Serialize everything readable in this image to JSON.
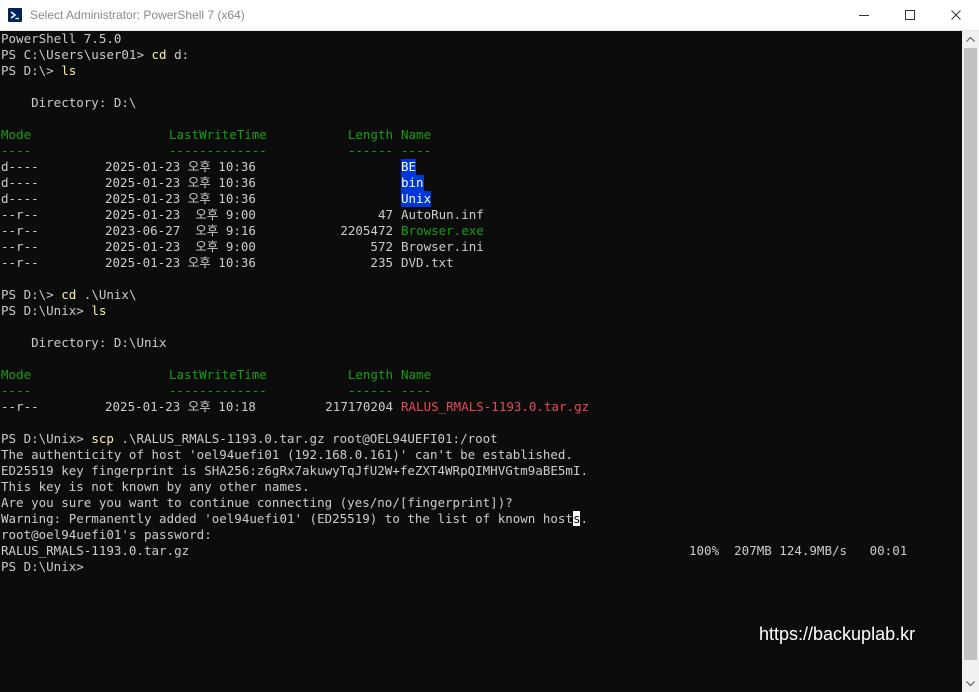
{
  "window": {
    "title": "Select Administrator: PowerShell 7 (x64)",
    "icon": "powershell-icon",
    "controls": [
      "minimize-icon",
      "maximize-icon",
      "close-icon"
    ]
  },
  "console": {
    "lines": [
      {
        "segments": [
          {
            "text": "PowerShell 7.5.0"
          }
        ]
      },
      {
        "segments": [
          {
            "text": "PS C:\\Users\\user01> "
          },
          {
            "text": "cd",
            "style": "yellow"
          },
          {
            "text": " d:"
          }
        ]
      },
      {
        "segments": [
          {
            "text": "PS D:\\> "
          },
          {
            "text": "ls",
            "style": "yellow"
          }
        ]
      },
      {
        "segments": []
      },
      {
        "segments": [
          {
            "text": "    Directory: D:\\"
          }
        ]
      },
      {
        "segments": []
      },
      {
        "segments": [
          {
            "text": "Mode",
            "style": "green"
          },
          {
            "text": "LastWriteTime",
            "style": "green"
          },
          {
            "text": "Length",
            "style": "green"
          },
          {
            "text": "Name",
            "style": "green"
          }
        ]
      },
      {
        "segments": [
          {
            "text": "----",
            "style": "green"
          },
          {
            "text": "-------------",
            "style": "green"
          },
          {
            "text": "------",
            "style": "green"
          },
          {
            "text": "----",
            "style": "green"
          }
        ]
      },
      {
        "segments": [
          {
            "text": "d----"
          },
          {
            "text": "2025-01-23 오후 10:36"
          },
          {
            "text": ""
          },
          {
            "text": "BE",
            "style": "dir"
          }
        ]
      },
      {
        "segments": [
          {
            "text": "d----"
          },
          {
            "text": "2025-01-23 오후 10:36"
          },
          {
            "text": ""
          },
          {
            "text": "bin",
            "style": "dir"
          }
        ]
      },
      {
        "segments": [
          {
            "text": "d----"
          },
          {
            "text": "2025-01-23 오후 10:36"
          },
          {
            "text": ""
          },
          {
            "text": "Unix",
            "style": "dir"
          }
        ]
      },
      {
        "segments": [
          {
            "text": "--r--"
          },
          {
            "text": "2025-01-23  오후 9:00"
          },
          {
            "text": "47"
          },
          {
            "text": "AutoRun.inf"
          }
        ]
      },
      {
        "segments": [
          {
            "text": "--r--"
          },
          {
            "text": "2023-06-27  오후 9:16"
          },
          {
            "text": "2205472"
          },
          {
            "text": "Browser.exe",
            "style": "green"
          }
        ]
      },
      {
        "segments": [
          {
            "text": "--r--"
          },
          {
            "text": "2025-01-23  오후 9:00"
          },
          {
            "text": "572"
          },
          {
            "text": "Browser.ini"
          }
        ]
      },
      {
        "segments": [
          {
            "text": "--r--"
          },
          {
            "text": "2025-01-23 오후 10:36"
          },
          {
            "text": "235"
          },
          {
            "text": "DVD.txt"
          }
        ]
      },
      {
        "segments": []
      },
      {
        "segments": [
          {
            "text": "PS D:\\> "
          },
          {
            "text": "cd",
            "style": "yellow"
          },
          {
            "text": " .\\Unix\\"
          }
        ]
      },
      {
        "segments": [
          {
            "text": "PS D:\\Unix> "
          },
          {
            "text": "ls",
            "style": "yellow"
          }
        ]
      },
      {
        "segments": []
      },
      {
        "segments": [
          {
            "text": "    Directory: D:\\Unix"
          }
        ]
      },
      {
        "segments": []
      },
      {
        "segments": [
          {
            "text": "Mode",
            "style": "green"
          },
          {
            "text": "LastWriteTime",
            "style": "green"
          },
          {
            "text": "Length",
            "style": "green"
          },
          {
            "text": "Name",
            "style": "green"
          }
        ]
      },
      {
        "segments": [
          {
            "text": "----",
            "style": "green"
          },
          {
            "text": "-------------",
            "style": "green"
          },
          {
            "text": "------",
            "style": "green"
          },
          {
            "text": "----",
            "style": "green"
          }
        ]
      },
      {
        "segments": [
          {
            "text": "--r--"
          },
          {
            "text": "2025-01-23 오후 10:18"
          },
          {
            "text": "217170204"
          },
          {
            "text": "RALUS_RMALS-1193.0.tar.gz",
            "style": "red"
          }
        ]
      },
      {
        "segments": []
      },
      {
        "segments": [
          {
            "text": "PS D:\\Unix> "
          },
          {
            "text": "scp",
            "style": "yellow"
          },
          {
            "text": " .\\RALUS_RMALS-1193.0.tar.gz root@OEL94UEFI01:/root"
          }
        ]
      },
      {
        "segments": [
          {
            "text": "The authenticity of host 'oel94uefi01 (192.168.0.161)' can't be established."
          }
        ]
      },
      {
        "segments": [
          {
            "text": "ED25519 key fingerprint is SHA256:z6gRx7akuwyTqJfU2W+feZXT4WRpQIMHVGtm9aBE5mI."
          }
        ]
      },
      {
        "segments": [
          {
            "text": "This key is not known by any other names."
          }
        ]
      },
      {
        "segments": [
          {
            "text": "Are you sure you want to continue connecting (yes/no/[fingerprint])?"
          }
        ]
      },
      {
        "segments": [
          {
            "text": "Warning: Permanently added 'oel94uefi01' (ED25519) to the list of known host"
          },
          {
            "text": "s",
            "style": "cursor"
          },
          {
            "text": "."
          }
        ]
      },
      {
        "segments": [
          {
            "text": "root@oel94uefi01's password:"
          }
        ]
      },
      {
        "segments": [
          {
            "text": "RALUS_RMALS-1193.0.tar.gz"
          },
          {
            "text": "100%  207MB 124.9MB/s   00:01"
          }
        ]
      },
      {
        "segments": [
          {
            "text": "PS D:\\Unix>"
          }
        ]
      }
    ]
  },
  "watermark": "https://backuplab.kr",
  "colors": {
    "background": "#0c0c0c",
    "foreground": "#cccccc",
    "header_green": "#13a10e",
    "command_yellow": "#f9f1a5",
    "archive_red": "#e74856",
    "directory_highlight": "#0037da"
  }
}
